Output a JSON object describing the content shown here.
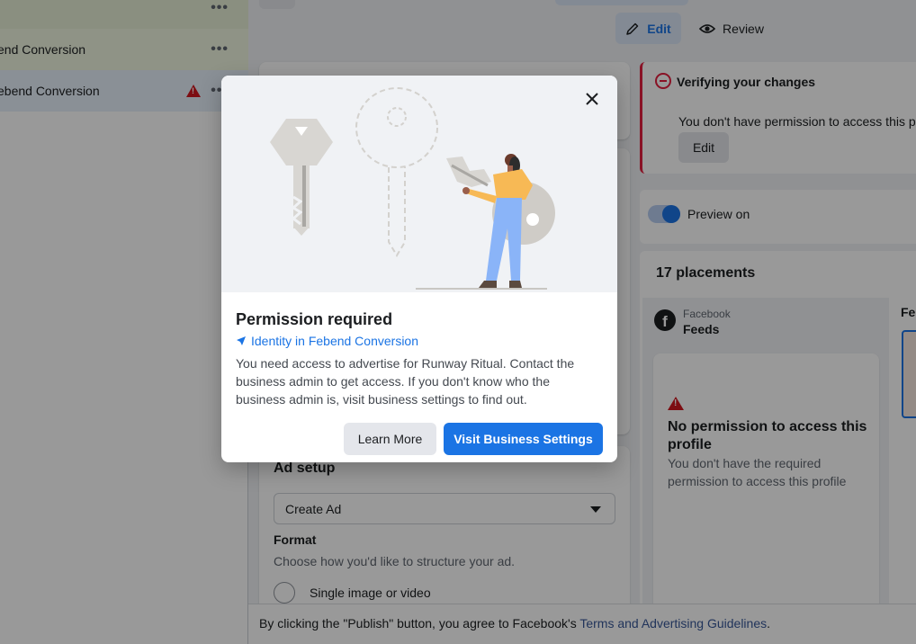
{
  "left_panel": {
    "rows": [
      {
        "label": "end Conversion",
        "more": "•••"
      },
      {
        "label": "ebend Conversion",
        "more": "•••"
      }
    ]
  },
  "toolbar": {
    "edit_label": "Edit",
    "review_label": "Review"
  },
  "verify_card": {
    "title": "Verifying your changes",
    "text": "You don't have permission to access this pr",
    "edit_label": "Edit"
  },
  "preview": {
    "label": "Preview on",
    "enabled": true
  },
  "placements": {
    "title": "17 placements",
    "platform": "Facebook",
    "position": "Feeds",
    "logo_letter": "f",
    "right_label": "Fe",
    "no_permission": {
      "title": "No permission to access this profile",
      "text": "You don't have the required permission to access this profile"
    }
  },
  "ad_setup": {
    "title": "Ad setup",
    "select_value": "Create Ad",
    "format_title": "Format",
    "format_subtitle": "Choose how you'd like to structure your ad.",
    "option_single": "Single image or video"
  },
  "footer": {
    "text_prefix": "By clicking the \"Publish\" button, you agree to Facebook's ",
    "link_text": "Terms and Advertising Guidelines",
    "text_suffix": "."
  },
  "modal": {
    "title": "Permission required",
    "identity_link": "Identity in Febend Conversion",
    "body": "You need access to advertise for Runway Ritual. Contact the business admin to get access. If you don't know who the business admin is, visit business settings to find out.",
    "learn_more_label": "Learn More",
    "visit_settings_label": "Visit Business Settings"
  },
  "colors": {
    "accent_blue": "#1b74e4",
    "error_red": "#e41e3f",
    "warning_red": "#d0171f",
    "overlay": "rgba(0,0,0,0.40)"
  },
  "icons": [
    "more-icon",
    "warning-icon",
    "pencil-icon",
    "eye-icon",
    "minus-circle-icon",
    "facebook-logo",
    "close-icon",
    "location-arrow-icon",
    "caret-down-icon"
  ]
}
